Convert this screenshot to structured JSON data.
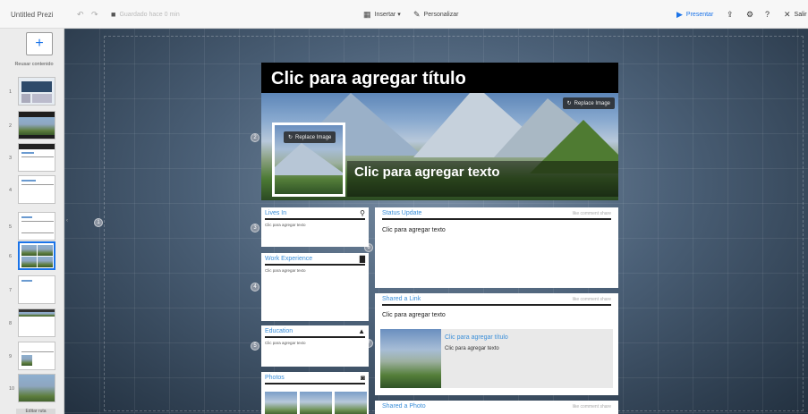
{
  "toolbar": {
    "doc_title": "Untitled Prezi",
    "undo_icon": "undo-icon",
    "redo_icon": "redo-icon",
    "save_status": "Guardado hace 0 min",
    "insert_label": "Insertar",
    "customize_label": "Personalizar",
    "present_label": "Presentar",
    "exit_label": "Salir"
  },
  "sidebar": {
    "add_label": "+",
    "reuse_label": "Reusar contenido",
    "thumbs": [
      "1",
      "2",
      "3",
      "4",
      "5",
      "6",
      "7",
      "8",
      "9",
      "10"
    ],
    "footer_label": "Editar ruta"
  },
  "canvas": {
    "markers": [
      "1",
      "2",
      "3",
      "4",
      "5",
      "6",
      "7"
    ]
  },
  "slide": {
    "title": "Clic para agregar título",
    "header_text": "Clic para agregar texto",
    "replace_image": "Replace Image",
    "lives_in": {
      "title": "Lives In",
      "body": "Clic para agregar texto",
      "icon": "map-pin-icon"
    },
    "work": {
      "title": "Work Experience",
      "body": "Clic para agregar texto",
      "icon": "briefcase-icon"
    },
    "education": {
      "title": "Education",
      "body": "Clic para agregar texto",
      "icon": "graduation-cap-icon"
    },
    "photos": {
      "title": "Photos",
      "icon": "camera-icon"
    },
    "status": {
      "title": "Status Update",
      "actions": "like  comment  share",
      "body": "Clic para agregar texto"
    },
    "shared_link": {
      "title": "Shared a Link",
      "actions": "like  comment  share",
      "body": "Clic para agregar texto",
      "link_title": "Clic para agregar título",
      "link_text": "Clic para agregar texto"
    },
    "shared_photo": {
      "title": "Shared a Photo",
      "actions": "like  comment  share"
    }
  },
  "colors": {
    "accent": "#1a73e8",
    "card_title": "#3a8ed8"
  }
}
